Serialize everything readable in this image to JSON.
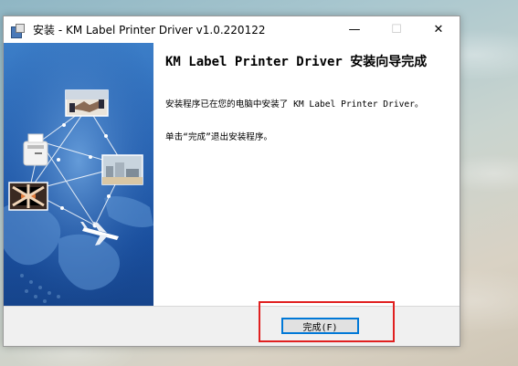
{
  "window": {
    "title": "安装 - KM Label Printer Driver v1.0.220122",
    "controls": {
      "minimize": "—",
      "maximize": "☐",
      "close": "✕"
    }
  },
  "content": {
    "heading": "KM Label Printer Driver 安装向导完成",
    "paragraph1": "安装程序已在您的电脑中安装了 KM Label Printer Driver。",
    "paragraph2": "单击“完成”退出安装程序。"
  },
  "footer": {
    "finish_label": "完成(F)"
  },
  "colors": {
    "banner_blue": "#2a66b5",
    "focus_border": "#0078d7",
    "highlight_red": "#e02020"
  }
}
